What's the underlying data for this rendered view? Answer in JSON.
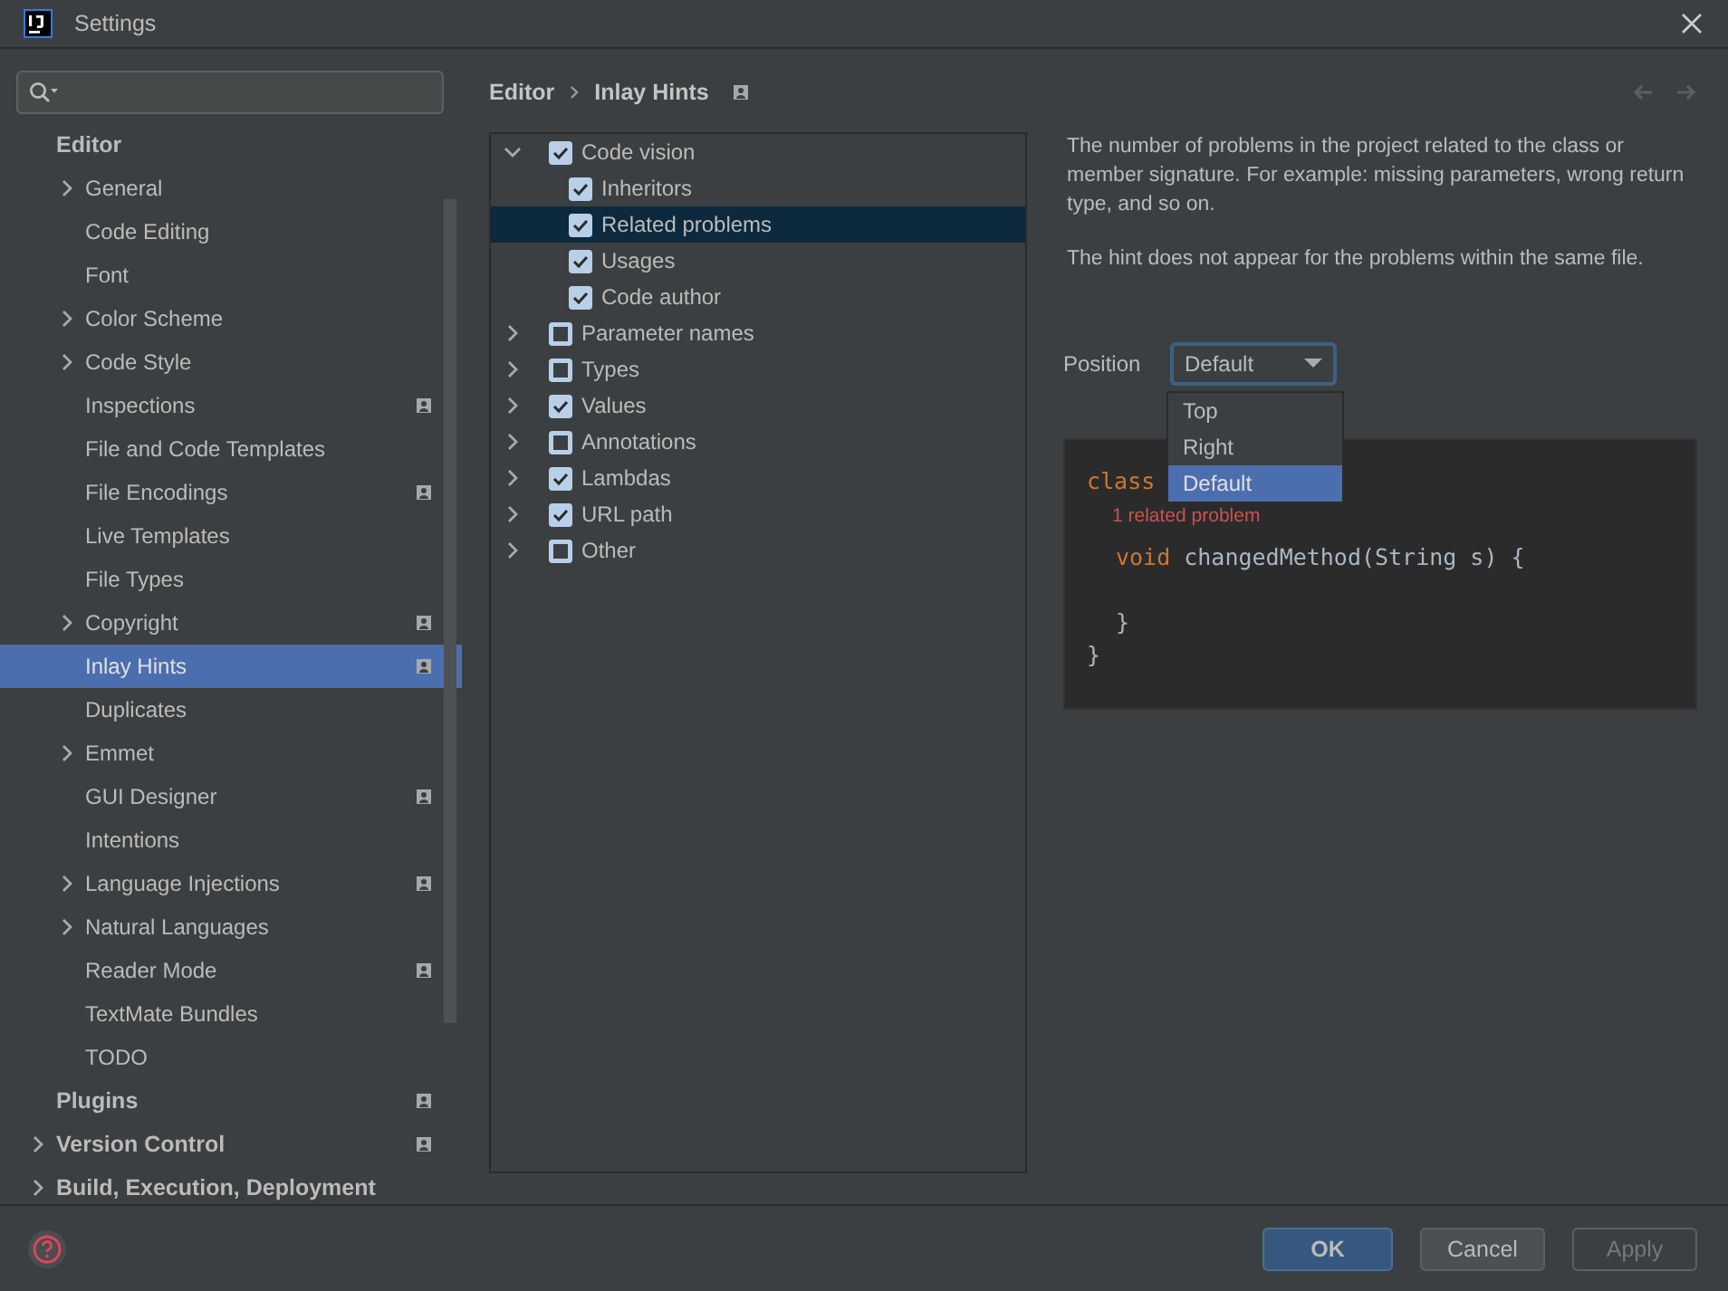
{
  "window": {
    "title": "Settings"
  },
  "sidebar": {
    "items": [
      {
        "label": "Editor",
        "expanded": true,
        "selected": false,
        "project": false,
        "children": [
          {
            "label": "General",
            "expandable": true,
            "selected": false,
            "project": false
          },
          {
            "label": "Code Editing",
            "expandable": false,
            "selected": false,
            "project": false
          },
          {
            "label": "Font",
            "expandable": false,
            "selected": false,
            "project": false
          },
          {
            "label": "Color Scheme",
            "expandable": true,
            "selected": false,
            "project": false
          },
          {
            "label": "Code Style",
            "expandable": true,
            "selected": false,
            "project": false
          },
          {
            "label": "Inspections",
            "expandable": false,
            "selected": false,
            "project": true
          },
          {
            "label": "File and Code Templates",
            "expandable": false,
            "selected": false,
            "project": false
          },
          {
            "label": "File Encodings",
            "expandable": false,
            "selected": false,
            "project": true
          },
          {
            "label": "Live Templates",
            "expandable": false,
            "selected": false,
            "project": false
          },
          {
            "label": "File Types",
            "expandable": false,
            "selected": false,
            "project": false
          },
          {
            "label": "Copyright",
            "expandable": true,
            "selected": false,
            "project": true
          },
          {
            "label": "Inlay Hints",
            "expandable": false,
            "selected": true,
            "project": true
          },
          {
            "label": "Duplicates",
            "expandable": false,
            "selected": false,
            "project": false
          },
          {
            "label": "Emmet",
            "expandable": true,
            "selected": false,
            "project": false
          },
          {
            "label": "GUI Designer",
            "expandable": false,
            "selected": false,
            "project": true
          },
          {
            "label": "Intentions",
            "expandable": false,
            "selected": false,
            "project": false
          },
          {
            "label": "Language Injections",
            "expandable": true,
            "selected": false,
            "project": true
          },
          {
            "label": "Natural Languages",
            "expandable": true,
            "selected": false,
            "project": false
          },
          {
            "label": "Reader Mode",
            "expandable": false,
            "selected": false,
            "project": true
          },
          {
            "label": "TextMate Bundles",
            "expandable": false,
            "selected": false,
            "project": false
          },
          {
            "label": "TODO",
            "expandable": false,
            "selected": false,
            "project": false
          }
        ]
      },
      {
        "label": "Plugins",
        "expanded": false,
        "expandable": false,
        "selected": false,
        "project": true
      },
      {
        "label": "Version Control",
        "expanded": false,
        "expandable": true,
        "selected": false,
        "project": true
      },
      {
        "label": "Build, Execution, Deployment",
        "expanded": false,
        "expandable": true,
        "selected": false,
        "project": false
      }
    ]
  },
  "breadcrumb": {
    "items": [
      "Editor",
      "Inlay Hints"
    ],
    "project": true
  },
  "hints_tree": {
    "items": [
      {
        "label": "Code vision",
        "checked": true,
        "partial": false,
        "expanded": true,
        "selected": false,
        "children": [
          {
            "label": "Inheritors",
            "checked": true,
            "selected": false
          },
          {
            "label": "Related problems",
            "checked": true,
            "selected": true
          },
          {
            "label": "Usages",
            "checked": true,
            "selected": false
          },
          {
            "label": "Code author",
            "checked": true,
            "selected": false
          }
        ]
      },
      {
        "label": "Parameter names",
        "partial": true,
        "expanded": false,
        "selected": false
      },
      {
        "label": "Types",
        "partial": true,
        "expanded": false,
        "selected": false
      },
      {
        "label": "Values",
        "checked": true,
        "partial": false,
        "expanded": false,
        "selected": false
      },
      {
        "label": "Annotations",
        "partial": true,
        "expanded": false,
        "selected": false
      },
      {
        "label": "Lambdas",
        "checked": true,
        "partial": false,
        "expanded": false,
        "selected": false
      },
      {
        "label": "URL path",
        "checked": true,
        "partial": false,
        "expanded": false,
        "selected": false
      },
      {
        "label": "Other",
        "partial": true,
        "expanded": false,
        "selected": false
      }
    ]
  },
  "description": [
    "The number of problems in the project related to the class or member signature. For example: missing parameters, wrong return type, and so on.",
    "The hint does not appear for the problems within the same file."
  ],
  "position": {
    "label": "Position",
    "value": "Default",
    "options": [
      {
        "label": "Top",
        "selected": false
      },
      {
        "label": "Right",
        "selected": false
      },
      {
        "label": "Default",
        "selected": true
      }
    ]
  },
  "preview": {
    "lines": [
      {
        "kind": "keyword",
        "text": "class"
      },
      {
        "kind": "hint",
        "text": "1 related problem"
      },
      {
        "kind": "method",
        "keyword": "void",
        "text": "changedMethod(String s) {"
      },
      {
        "kind": "blank"
      },
      {
        "kind": "close",
        "text": "}"
      },
      {
        "kind": "close0",
        "text": "}"
      }
    ]
  },
  "buttons": [
    {
      "label": "OK",
      "kind": "primary"
    },
    {
      "label": "Cancel",
      "kind": "normal"
    },
    {
      "label": "Apply",
      "kind": "disabled"
    }
  ]
}
